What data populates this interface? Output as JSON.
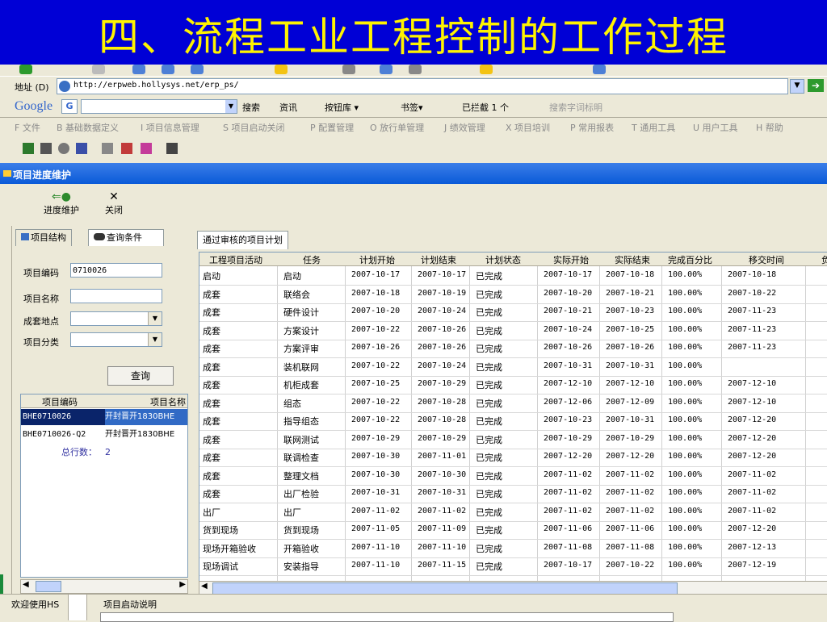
{
  "slide_title": "四、流程工业工程控制的工作过程",
  "address": {
    "label": "地址 (D)",
    "url": "http://erpweb.hollysys.net/erp_ps/"
  },
  "google": {
    "logo": "Google",
    "g": "G",
    "items": [
      "搜索",
      "资讯",
      "按钮库 ▾",
      "书签▾",
      "已拦截 1 个",
      "搜索字词标明"
    ]
  },
  "menu": [
    "F 文件",
    "B 基础数据定义",
    "I 项目信息管理",
    "S 项目启动关闭",
    "P 配置管理",
    "O 放行单管理",
    "J 绩效管理",
    "X 项目培训",
    "P 常用报表",
    "T 通用工具",
    "U 用户工具",
    "H 帮助"
  ],
  "window_title": "项目进度维护",
  "actions": {
    "progress": "进度维护",
    "close": "关闭",
    "progress_icon": "⇐●",
    "close_icon": "✕"
  },
  "left": {
    "tabs": [
      "项目结构",
      "查询条件"
    ],
    "fields": {
      "code_label": "项目编码",
      "code_value": "0710026",
      "name_label": "项目名称",
      "name_value": "",
      "location_label": "成套地点",
      "category_label": "项目分类"
    },
    "query_button": "查询",
    "table_headers": [
      "项目编码",
      "项目名称"
    ],
    "rows": [
      {
        "code": "BHE0710026",
        "name": "开封晋开1830BHE"
      },
      {
        "code": "BHE0710026-Q2",
        "name": "开封晋开1830BHE"
      }
    ],
    "total_label": "总行数：",
    "total_value": "2"
  },
  "right": {
    "tab": "通过审核的项目计划",
    "headers": [
      "工程项目活动",
      "任务",
      "计划开始",
      "计划结束",
      "计划状态",
      "实际开始",
      "实际结束",
      "完成百分比",
      "移交时间",
      "负"
    ],
    "rows": [
      [
        "启动",
        "启动",
        "2007-10-17",
        "2007-10-17",
        "已完成",
        "2007-10-17",
        "2007-10-18",
        "100.00%",
        "2007-10-18"
      ],
      [
        "成套",
        "联络会",
        "2007-10-18",
        "2007-10-19",
        "已完成",
        "2007-10-20",
        "2007-10-21",
        "100.00%",
        "2007-10-22"
      ],
      [
        "成套",
        "硬件设计",
        "2007-10-20",
        "2007-10-24",
        "已完成",
        "2007-10-21",
        "2007-10-23",
        "100.00%",
        "2007-11-23"
      ],
      [
        "成套",
        "方案设计",
        "2007-10-22",
        "2007-10-26",
        "已完成",
        "2007-10-24",
        "2007-10-25",
        "100.00%",
        "2007-11-23"
      ],
      [
        "成套",
        "方案评审",
        "2007-10-26",
        "2007-10-26",
        "已完成",
        "2007-10-26",
        "2007-10-26",
        "100.00%",
        "2007-11-23"
      ],
      [
        "成套",
        "装机联网",
        "2007-10-22",
        "2007-10-24",
        "已完成",
        "2007-10-31",
        "2007-10-31",
        "100.00%",
        ""
      ],
      [
        "成套",
        "机柜成套",
        "2007-10-25",
        "2007-10-29",
        "已完成",
        "2007-12-10",
        "2007-12-10",
        "100.00%",
        "2007-12-10"
      ],
      [
        "成套",
        "组态",
        "2007-10-22",
        "2007-10-28",
        "已完成",
        "2007-12-06",
        "2007-12-09",
        "100.00%",
        "2007-12-10"
      ],
      [
        "成套",
        "指导组态",
        "2007-10-22",
        "2007-10-28",
        "已完成",
        "2007-10-23",
        "2007-10-31",
        "100.00%",
        "2007-12-20"
      ],
      [
        "成套",
        "联网测试",
        "2007-10-29",
        "2007-10-29",
        "已完成",
        "2007-10-29",
        "2007-10-29",
        "100.00%",
        "2007-12-20"
      ],
      [
        "成套",
        "联调检查",
        "2007-10-30",
        "2007-11-01",
        "已完成",
        "2007-12-20",
        "2007-12-20",
        "100.00%",
        "2007-12-20"
      ],
      [
        "成套",
        "整理文档",
        "2007-10-30",
        "2007-10-30",
        "已完成",
        "2007-11-02",
        "2007-11-02",
        "100.00%",
        "2007-11-02"
      ],
      [
        "成套",
        "出厂检验",
        "2007-10-31",
        "2007-10-31",
        "已完成",
        "2007-11-02",
        "2007-11-02",
        "100.00%",
        "2007-11-02"
      ],
      [
        "出厂",
        "出厂",
        "2007-11-02",
        "2007-11-02",
        "已完成",
        "2007-11-02",
        "2007-11-02",
        "100.00%",
        "2007-11-02"
      ],
      [
        "货到现场",
        "货到现场",
        "2007-11-05",
        "2007-11-09",
        "已完成",
        "2007-11-06",
        "2007-11-06",
        "100.00%",
        "2007-12-20"
      ],
      [
        "现场开箱验收",
        "开箱验收",
        "2007-11-10",
        "2007-11-10",
        "已完成",
        "2007-11-08",
        "2007-11-08",
        "100.00%",
        "2007-12-13"
      ],
      [
        "现场调试",
        "安装指导",
        "2007-11-10",
        "2007-11-15",
        "已完成",
        "2007-10-17",
        "2007-10-22",
        "100.00%",
        "2007-12-19"
      ]
    ]
  },
  "bottom": {
    "welcome": "欢迎使用HS",
    "desc": "项目启动说明"
  }
}
